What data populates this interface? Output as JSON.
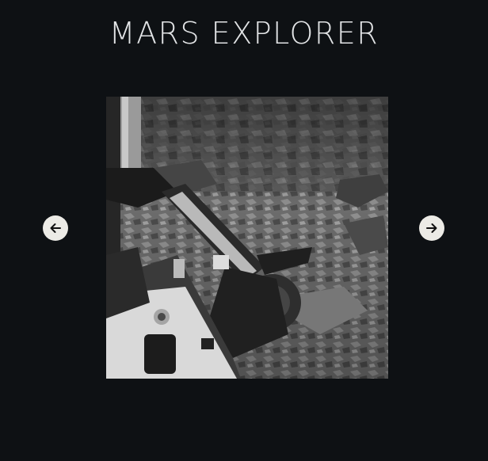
{
  "app": {
    "title": "MARS EXPLORER"
  },
  "carousel": {
    "prev_icon": "arrow-left-icon",
    "next_icon": "arrow-right-icon",
    "photo": {
      "description_hidden": true
    }
  },
  "colors": {
    "background": "#0e1114",
    "title": "#e2e4e6",
    "button_bg": "#ecebe6",
    "button_icon": "#111111"
  }
}
